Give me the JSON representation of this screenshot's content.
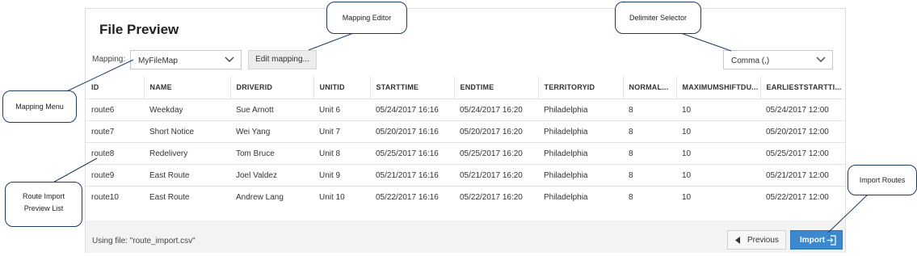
{
  "panel": {
    "title": "File Preview",
    "mapping_label": "Mapping:",
    "mapping_value": "MyFileMap",
    "edit_mapping_label": "Edit mapping...",
    "delimiter_value": "Comma (,)"
  },
  "table": {
    "headers": [
      "ID",
      "NAME",
      "DRIVERID",
      "UNITID",
      "STARTTIME",
      "ENDTIME",
      "TERRITORYID",
      "NORMAL...",
      "MAXIMUMSHIFTDU...",
      "EARLIESTSTARTTI..."
    ],
    "rows": [
      [
        "route6",
        "Weekday",
        "Sue Arnott",
        "Unit 6",
        "05/24/2017 16:16",
        "05/24/2017 16:20",
        "Philadelphia",
        "8",
        "10",
        "05/24/2017 12:00"
      ],
      [
        "route7",
        "Short Notice",
        "Wei Yang",
        "Unit 7",
        "05/20/2017 16:16",
        "05/20/2017 16:20",
        "Philadelphia",
        "8",
        "10",
        "05/20/2017 12:00"
      ],
      [
        "route8",
        "Redelivery",
        "Tom Bruce",
        "Unit 8",
        "05/25/2017 16:16",
        "05/25/2017 16:20",
        "Philadelphia",
        "8",
        "10",
        "05/25/2017 12:00"
      ],
      [
        "route9",
        "East Route",
        "Joel Valdez",
        "Unit 9",
        "05/21/2017 16:16",
        "05/21/2017 16:20",
        "Philadelphia",
        "8",
        "10",
        "05/21/2017 12:00"
      ],
      [
        "route10",
        "East Route",
        "Andrew Lang",
        "Unit 10",
        "05/22/2017 16:16",
        "05/22/2017 16:20",
        "Philadelphia",
        "8",
        "10",
        "05/22/2017 12:00"
      ]
    ]
  },
  "footer": {
    "using_file": "Using file: \"route_import.csv\"",
    "previous_label": "Previous",
    "import_label": "Import"
  },
  "callouts": {
    "mapping_editor": "Mapping Editor",
    "delimiter_selector": "Delimiter Selector",
    "mapping_menu": "Mapping Menu",
    "route_import_line1": "Route Import",
    "route_import_line2": "Preview List",
    "import_routes": "Import Routes"
  },
  "colors": {
    "primary_button": "#3d88cc",
    "callout_border": "#1f3a60"
  },
  "icons": [
    "chevron-down-icon",
    "previous-arrow-icon",
    "import-icon"
  ]
}
